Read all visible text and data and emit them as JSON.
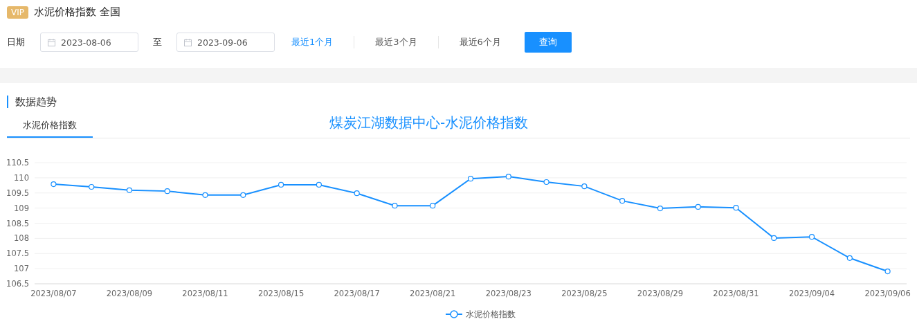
{
  "header": {
    "badge": "VIP",
    "title": "水泥价格指数 全国"
  },
  "filter": {
    "date_label": "日期",
    "start_date": "2023-08-06",
    "separator": "至",
    "end_date": "2023-09-06",
    "ranges": [
      {
        "label": "最近1个月",
        "selected": true
      },
      {
        "label": "最近3个月",
        "selected": false
      },
      {
        "label": "最近6个月",
        "selected": false
      }
    ],
    "query_button": "查询"
  },
  "section": {
    "title": "数据趋势",
    "tabs": [
      {
        "label": "水泥价格指数",
        "selected": true
      }
    ],
    "chart_data": {
      "type": "line",
      "title": "煤炭江湖数据中心-水泥价格指数",
      "categories": [
        "2023/08/07",
        null,
        "2023/08/09",
        null,
        "2023/08/11",
        null,
        "2023/08/15",
        null,
        "2023/08/17",
        null,
        "2023/08/21",
        null,
        "2023/08/23",
        null,
        "2023/08/25",
        null,
        "2023/08/29",
        null,
        "2023/08/31",
        null,
        "2023/09/04",
        null,
        "2023/09/06"
      ],
      "ylim": [
        106.5,
        110.5
      ],
      "grid": true,
      "yticks": [
        106.5,
        107,
        {
          "value": 107.5,
          "label": "107.5"
        },
        108,
        108.5,
        109,
        109.5,
        110,
        110.5
      ],
      "series": [
        {
          "name": "水泥价格指数",
          "color": "#1890ff",
          "marker": "circle",
          "values": [
            109.79,
            109.7,
            109.59,
            109.56,
            109.43,
            109.43,
            109.77,
            109.77,
            109.49,
            109.08,
            109.08,
            109.97,
            110.04,
            109.86,
            109.72,
            109.24,
            108.99,
            109.04,
            109.01,
            108.01,
            108.05,
            107.35,
            106.91
          ]
        }
      ]
    }
  }
}
